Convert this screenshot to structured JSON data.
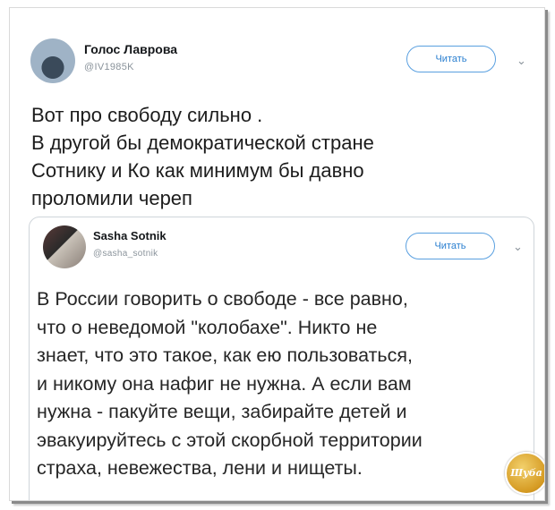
{
  "tweet": {
    "author_name": "Голос Лаврова",
    "author_handle": "@IV1985K",
    "follow_label": "Читать",
    "text": "Вот про свободу сильно .\nВ другой бы демократической стране\nСотнику и Ко как минимум бы давно\nпроломили череп"
  },
  "quoted_tweet": {
    "author_name": "Sasha Sotnik",
    "author_handle": "@sasha_sotnik",
    "follow_label": "Читать",
    "text": "В России говорить о свободе - все равно,\nчто о неведомой \"колобахе\". Никто не\nзнает, что это такое, как ею пользоваться,\nи никому она нафиг не нужна. А если вам\nнужна - пакуйте вещи, забирайте детей и\nэвакуируйтесь с этой скорбной территории\nстраха, невежества, лени и нищеты."
  },
  "watermark": {
    "text": "Шуба"
  },
  "icons": {
    "main_avatar": "avatar-icon",
    "quoted_avatar": "avatar-icon",
    "menu": "chevron-down-icon"
  },
  "colors": {
    "follow_border": "#5aa0e0",
    "follow_text": "#2a7fd0",
    "handle_gray": "#8a939b"
  }
}
